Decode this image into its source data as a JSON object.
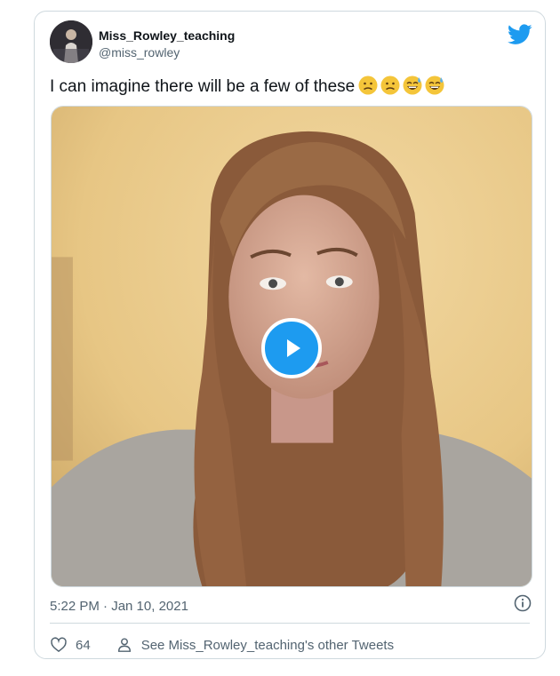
{
  "tweet": {
    "display_name": "Miss_Rowley_teaching",
    "handle": "@miss_rowley",
    "text": "I can imagine there will be a few of these",
    "emojis": [
      "confused-face",
      "confused-face",
      "grinning-sweat-face",
      "grinning-sweat-face"
    ],
    "timestamp": "5:22 PM · Jan 10, 2021",
    "likes": "64",
    "other_tweets_label": "See Miss_Rowley_teaching's other Tweets",
    "video_content": "video thumbnail with play button"
  },
  "colors": {
    "twitter_blue": "#1d9bf0",
    "secondary_text": "#536471",
    "border": "#cfd9de"
  },
  "icons": [
    "twitter-bird-icon",
    "info-icon",
    "heart-icon",
    "person-icon",
    "play-icon"
  ]
}
